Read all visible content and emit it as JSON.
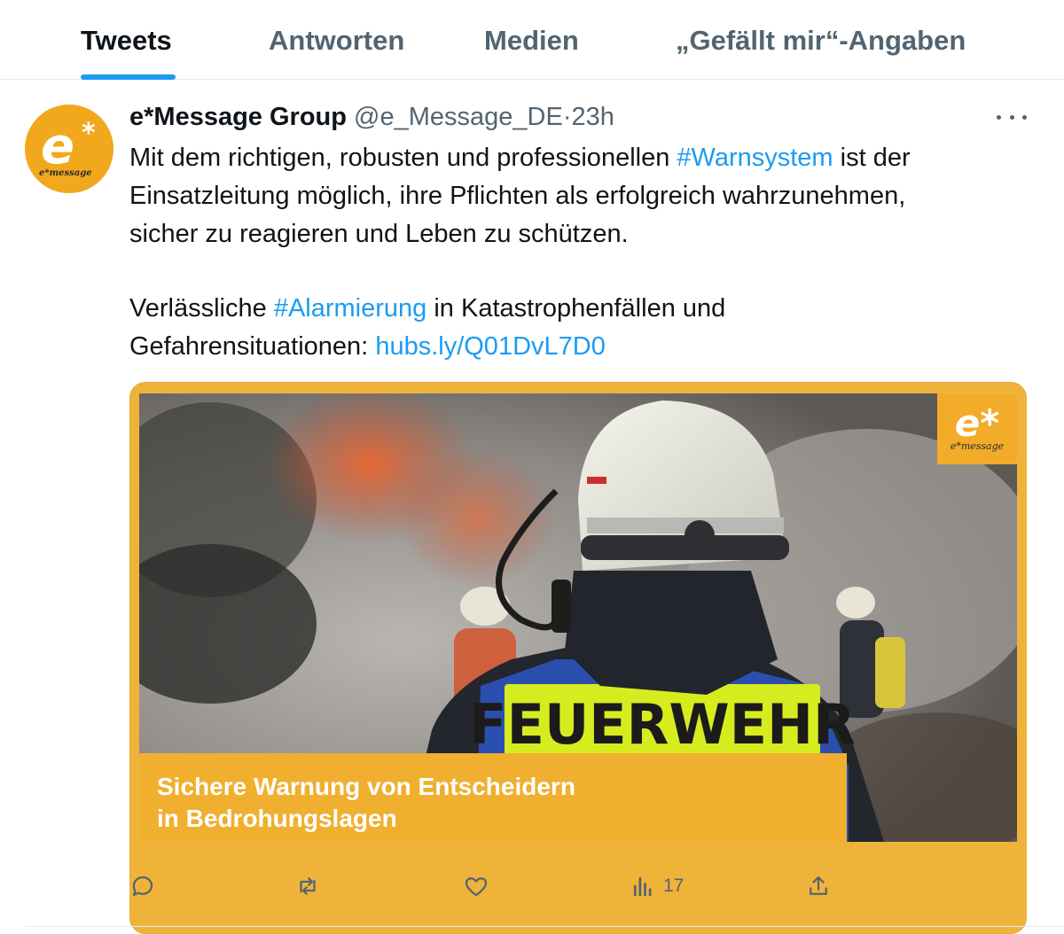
{
  "tabs": [
    {
      "label": "Tweets",
      "active": true
    },
    {
      "label": "Antworten",
      "active": false
    },
    {
      "label": "Medien",
      "active": false
    },
    {
      "label": "„Gefällt mir“-Angaben",
      "active": false
    }
  ],
  "tweet": {
    "author_name": "e*Message Group",
    "handle": "@e_Message_DE",
    "separator": "·",
    "time": "23h",
    "more_icon": "more-horizontal-icon",
    "avatar": {
      "logo_letter": "e*",
      "logo_text": "e*message",
      "color": "#f2a81d"
    },
    "text": {
      "p1_l1_a": "Mit dem richtigen, robusten und professionellen ",
      "p1_l1_tag": "#Warnsystem",
      "p1_l1_b": " ist der",
      "p1_l2": "Einsatzleitung möglich, ihre Pflichten als erfolgreich wahrzunehmen,",
      "p1_l3": "sicher zu reagieren und Leben zu schützen.",
      "p2_l1_a": "Verlässliche ",
      "p2_l1_tag": "#Alarmierung",
      "p2_l1_b": " in Katastrophenfällen und",
      "p2_l2_a": "Gefahrensituationen: ",
      "p2_l2_link": "hubs.ly/Q01DvL7D0"
    },
    "media": {
      "logo_letter": "e*",
      "logo_text": "e*message",
      "vest_text": "FEUERWEHR",
      "caption_line1": "Sichere Warnung von Entscheidern",
      "caption_line2": "in Bedrohungslagen",
      "accent_color": "#f0b33a"
    },
    "actions": {
      "reply_icon": "reply-icon",
      "retweet_icon": "retweet-icon",
      "like_icon": "heart-icon",
      "views_icon": "views-icon",
      "views_count": "17",
      "share_icon": "share-icon"
    }
  },
  "colors": {
    "link": "#1d9bf0",
    "muted": "#536471",
    "text": "#0f1419"
  }
}
